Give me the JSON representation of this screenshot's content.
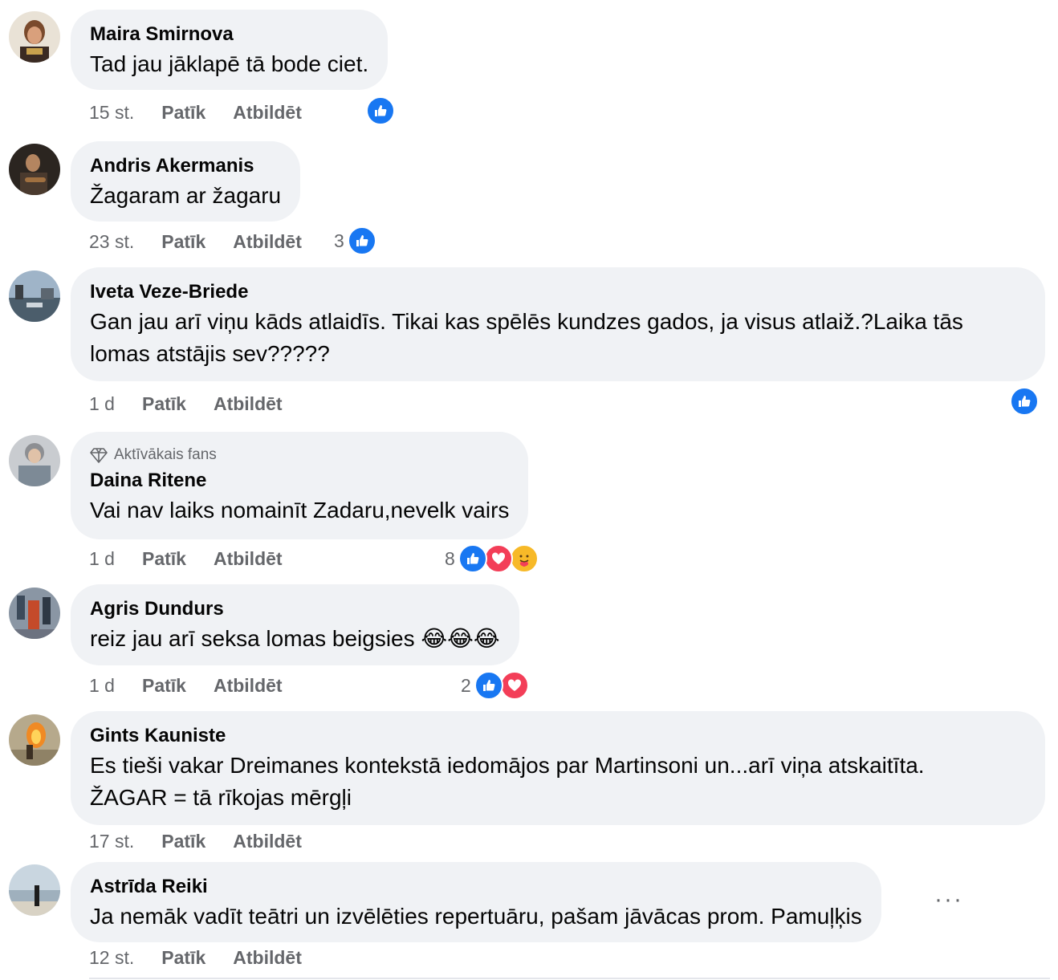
{
  "comments": [
    {
      "author": "Maira Smirnova",
      "text": "Tad jau jāklapē tā bode ciet.",
      "time": "15 st.",
      "like_label": "Patīk",
      "reply_label": "Atbildēt",
      "reaction_count": "",
      "reactions": [
        "like"
      ]
    },
    {
      "author": "Andris Akermanis",
      "text": "Žagaram ar žagaru",
      "time": "23 st.",
      "like_label": "Patīk",
      "reply_label": "Atbildēt",
      "reaction_count": "3",
      "reactions": [
        "like"
      ]
    },
    {
      "author": "Iveta Veze-Briede",
      "text": "Gan jau arī viņu kāds atlaidīs. Tikai kas spēlēs kundzes gados, ja visus atlaiž.?Laika tās lomas atstājis sev?????",
      "time": "1 d",
      "like_label": "Patīk",
      "reply_label": "Atbildēt",
      "reaction_count": "",
      "reactions": [
        "like"
      ]
    },
    {
      "badge": "Aktīvākais fans",
      "author": "Daina Ritene",
      "text": "Vai nav laiks nomainīt Zadaru,nevelk vairs",
      "time": "1 d",
      "like_label": "Patīk",
      "reply_label": "Atbildēt",
      "reaction_count": "8",
      "reactions": [
        "like",
        "love",
        "care"
      ]
    },
    {
      "author": "Agris Dundurs",
      "text": "reiz jau arī seksa lomas beigsies 😂😂😂",
      "time": "1 d",
      "like_label": "Patīk",
      "reply_label": "Atbildēt",
      "reaction_count": "2",
      "reactions": [
        "like",
        "love"
      ]
    },
    {
      "author": "Gints Kauniste",
      "text": "Es tieši vakar Dreimanes kontekstā iedomājos par Martinsoni un...arī viņa atskaitīta.\nŽAGAR = tā rīkojas mērgļi",
      "time": "17 st.",
      "like_label": "Patīk",
      "reply_label": "Atbildēt",
      "reaction_count": "",
      "reactions": []
    },
    {
      "author": "Astrīda Reiki",
      "text": "Ja nemāk vadīt teātri un izvēlēties repertuāru, pašam jāvācas prom. Pamuļķis",
      "time": "12 st.",
      "like_label": "Patīk",
      "reply_label": "Atbildēt",
      "reaction_count": "",
      "reactions": [],
      "more_label": "···"
    }
  ],
  "colors": {
    "like": "#1877f2",
    "love": "#f33e58",
    "care": "#f7b928",
    "bubble": "#f0f2f5",
    "meta": "#65676b"
  },
  "icons": {
    "badge": "diamond-icon",
    "like": "thumbs-up-icon",
    "love": "heart-icon",
    "care": "care-hug-icon",
    "more": "more-dots-icon"
  }
}
